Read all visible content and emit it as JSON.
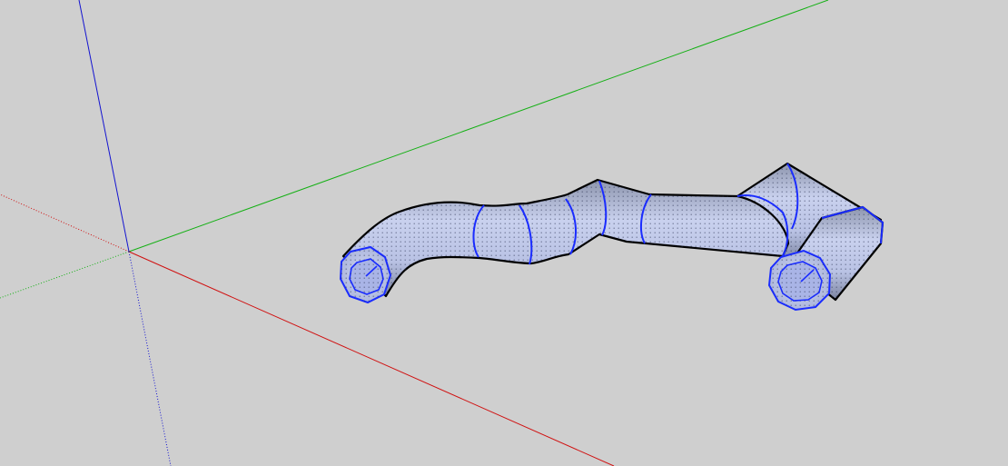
{
  "scene": {
    "background_color": "#cfcfcf",
    "axes": {
      "red_color": "#d01010",
      "green_color": "#14b014",
      "blue_color": "#1414d0"
    },
    "model": {
      "name": "pipe",
      "edge_color": "#1a2cff",
      "outline_color": "#000000",
      "face_color": "#c3cbe6"
    }
  }
}
